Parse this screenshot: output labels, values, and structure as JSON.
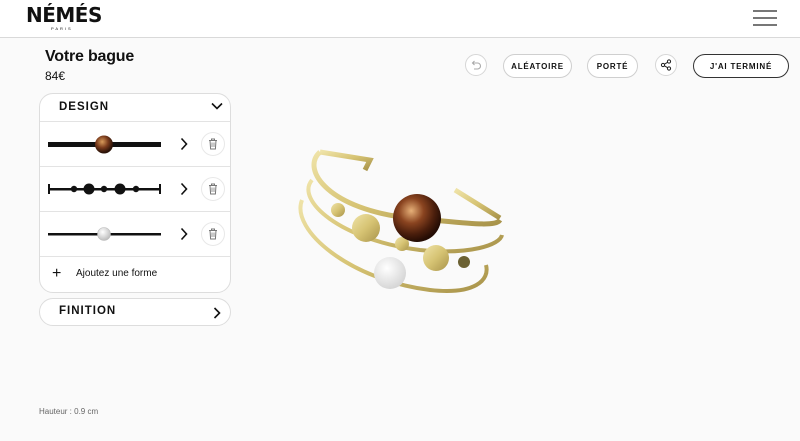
{
  "header": {
    "logo_text": "NÉMÉS",
    "logo_sub": "PARIS",
    "menu_icon": "hamburger-menu-icon"
  },
  "product": {
    "title": "Votre bague",
    "price": "84€"
  },
  "toolbar": {
    "undo_icon": "undo-icon",
    "random_label": "ALÉATOIRE",
    "worn_label": "PORTÉ",
    "share_icon": "share-icon",
    "done_label": "J'AI TERMINÉ"
  },
  "design_panel": {
    "title": "DESIGN",
    "toggle_icon": "chevron-down-icon",
    "rows": [
      {
        "shape_icon": "bar-with-tiger-eye-bead-icon",
        "arrow_icon": "chevron-right-icon",
        "delete_icon": "trash-icon"
      },
      {
        "shape_icon": "bar-with-dots-icon",
        "arrow_icon": "chevron-right-icon",
        "delete_icon": "trash-icon"
      },
      {
        "shape_icon": "bar-with-white-bead-icon",
        "arrow_icon": "chevron-right-icon",
        "delete_icon": "trash-icon"
      }
    ],
    "add_label": "Ajoutez une forme",
    "add_icon": "plus-icon"
  },
  "finish_panel": {
    "title": "FINITION",
    "toggle_icon": "chevron-right-icon"
  },
  "footer": {
    "height_label": "Hauteur : 0.9 cm"
  },
  "colors": {
    "gold": "#d8c87a",
    "gold_dark": "#b3a04e",
    "tiger_eye": "#7a3b1c",
    "pearl": "#f2f2f2",
    "text": "#111111",
    "border": "#dddddd"
  }
}
